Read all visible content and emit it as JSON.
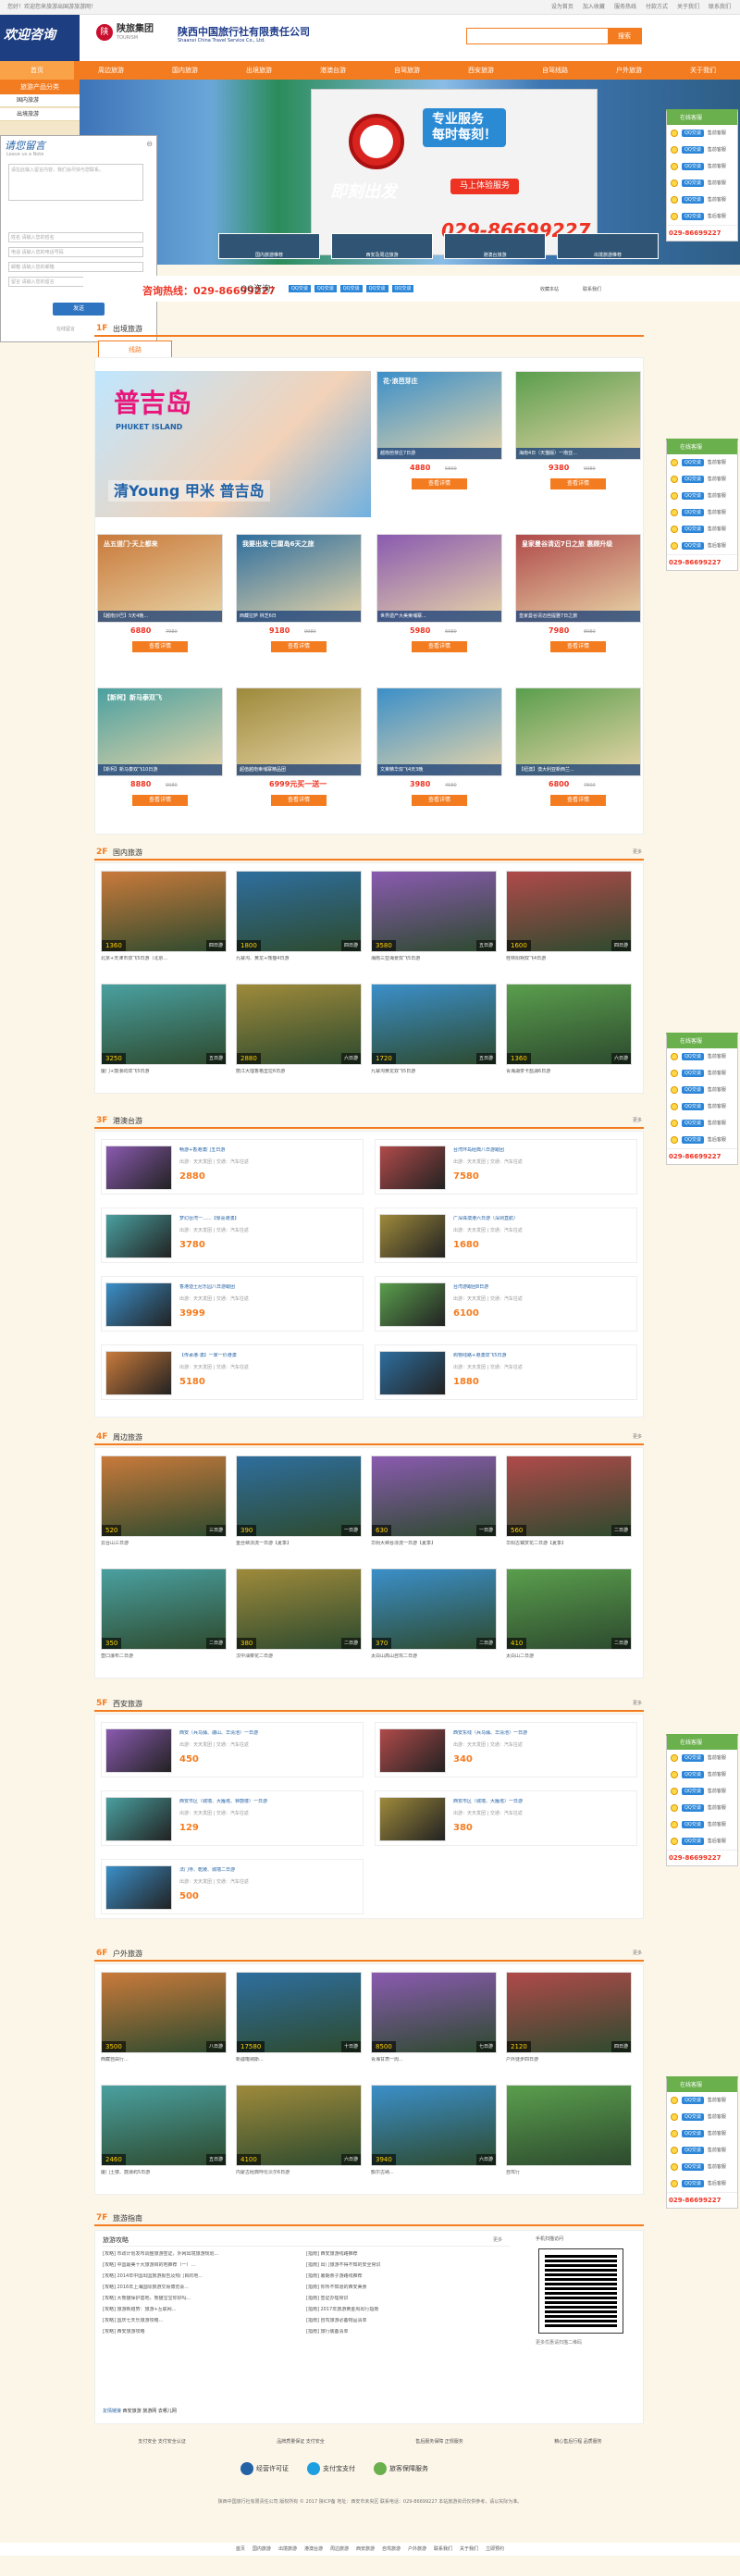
{
  "topbar": {
    "welcome": "您好！欢迎您来旅游出国游旅游网！",
    "links": [
      "设为首页",
      "加入收藏",
      "服务热线",
      "付款方式",
      "关于我们",
      "联系我们"
    ]
  },
  "header": {
    "corner": "欢迎咨询",
    "brand": "陕旅集团",
    "brand_en": "TOURISM",
    "cn": "陕西中国旅行社有限责任公司",
    "en": "Shaanxi China Travel Service Co., Ltd.",
    "search_placeholder": "",
    "search_btn": "搜索"
  },
  "nav": [
    "首页",
    "周边旅游",
    "国内旅游",
    "出境旅游",
    "港澳台游",
    "自驾旅游",
    "西安旅游",
    "自驾线路",
    "户外旅游",
    "关于我们"
  ],
  "leftmenu": {
    "title": "旅游产品分类",
    "items": [
      "国内旅游",
      "出境旅游"
    ]
  },
  "banner": {
    "clock_label": "专业服务",
    "clock_sub": "每时每刻！",
    "btn": "马上体验服务",
    "phone": "029-86699227",
    "slogan": "即刻出发",
    "thumbs": [
      "国内旅游推荐",
      "西安及周边旅游",
      "港澳台旅游",
      "出境旅游推荐"
    ]
  },
  "msgbox": {
    "title": "请您留言",
    "subtitle": "Leave us a Note",
    "textarea_ph": "请在此输入留言内容，我们会尽快与您联系。",
    "fields": [
      "姓名 请输入您的姓名",
      "电话 请输入您的电话号码",
      "邮箱 请输入您的邮箱",
      "留言 请输入您的留言"
    ],
    "send": "发送",
    "powered": "在线留言"
  },
  "cs": {
    "title": "在线客服",
    "items": [
      "售前客服",
      "售前客服",
      "售前客服",
      "售前客服",
      "售前客服",
      "售后客服"
    ],
    "qq": "QQ交谈",
    "phone": "029-86699227"
  },
  "hotline": {
    "tel": "咨询热线：029-86699227",
    "qq_label": "QQ咨询：",
    "qq": [
      "QQ交谈",
      "QQ交谈",
      "QQ交谈",
      "QQ交谈",
      "QQ交谈"
    ],
    "fav": "收藏本站",
    "contact": "联系我们"
  },
  "floors": [
    {
      "num": "1F",
      "title": "出境旅游",
      "tab": "线路"
    },
    {
      "num": "2F",
      "title": "国内旅游",
      "more": "更多"
    },
    {
      "num": "3F",
      "title": "港澳台游",
      "more": "更多"
    },
    {
      "num": "4F",
      "title": "周边旅游",
      "more": "更多"
    },
    {
      "num": "5F",
      "title": "西安旅游",
      "more": "更多"
    },
    {
      "num": "6F",
      "title": "户外旅游",
      "more": "更多"
    },
    {
      "num": "7F",
      "title": "旅游指南",
      "more": ""
    }
  ],
  "f1": {
    "big": {
      "title": "普吉岛",
      "en": "PHUKET ISLAND",
      "sub": "清Young 甲米 普吉岛"
    },
    "cards": [
      {
        "cap": "越南芭芽庄7日游",
        "price": "4880",
        "old": "5800",
        "btn": "查看详情",
        "label": "花·浪芭芽庄"
      },
      {
        "cap": "海南4日（天猫版）一南亚...",
        "price": "9380",
        "old": "9980",
        "btn": "查看详情"
      },
      {
        "cap": "【越南沙巴】5天4晚...",
        "price": "6880",
        "old": "7980",
        "btn": "查看详情",
        "label": "丛五道门·天上都来"
      },
      {
        "cap": "西藏拉萨 林芝6日",
        "price": "9180",
        "old": "9980",
        "btn": "查看详情",
        "label": "我要出发·巴厘岛6天之旅"
      },
      {
        "cap": "世界遗产大美柬埔寨...",
        "price": "5980",
        "old": "6980",
        "btn": "查看详情"
      },
      {
        "cap": "皇家曼谷清迈芭提雅7日之旅",
        "price": "7980",
        "old": "8980",
        "btn": "查看详情",
        "label": "皇家曼谷清迈7日之旅 惠顾升级"
      },
      {
        "cap": "【新柯】新马泰双飞10日游",
        "price": "8880",
        "old": "9980",
        "btn": "查看详情",
        "label": "【新柯】新马泰双飞"
      },
      {
        "cap": "超值越南柬埔寨精品团",
        "price": "6999元买一送一",
        "old": "",
        "btn": "查看详情"
      },
      {
        "cap": "文莱精华双飞4天3晚",
        "price": "3980",
        "old": "4580",
        "btn": "查看详情"
      },
      {
        "cap": "【纽澳】澳大利亚新西兰...",
        "price": "6800",
        "old": "7800",
        "btn": "查看详情"
      }
    ]
  },
  "f2": [
    {
      "cap": "北京+天津市双飞5日游（北京...",
      "price": "1360",
      "rd": "四日游"
    },
    {
      "cap": "九寨沟、黄龙+熊猫4日游",
      "price": "1800",
      "rd": "四日游"
    },
    {
      "cap": "海南三亚海景双飞5日游",
      "price": "3580",
      "rd": "五日游"
    },
    {
      "cap": "桂林阳朔双飞4日游",
      "price": "1600",
      "rd": "四日游"
    },
    {
      "cap": "厦门+鼓浪屿双飞5日游",
      "price": "3250",
      "rd": "五日游"
    },
    {
      "cap": "丽江大理香格里拉6日游",
      "price": "2880",
      "rd": "六日游"
    },
    {
      "cap": "九寨沟黄龙双飞5日游",
      "price": "1720",
      "rd": "五日游"
    },
    {
      "cap": "青海湖茶卡盐湖6日游",
      "price": "1360",
      "rd": "六日游"
    }
  ],
  "f3": [
    {
      "nm": "畅游+香港澳门五日游",
      "sb": "出游：天天发团 | 交通：汽车往返",
      "pz": "2880"
    },
    {
      "nm": "台湾环岛经典八日游跟团",
      "sb": "出游：天天发团 | 交通：汽车往返",
      "pz": "7580"
    },
    {
      "nm": "梦幻台湾一......【惊喜港澳】",
      "sb": "出游：天天发团 | 交通：汽车往返",
      "pz": "3780"
    },
    {
      "nm": "广深珠澳港六日游（深圳直航）",
      "sb": "出游：天天发团 | 交通：汽车往返",
      "pz": "1680"
    },
    {
      "nm": "香港迪士尼乐园八日游跟团",
      "sb": "出游：天天发团 | 交通：汽车往返",
      "pz": "3999"
    },
    {
      "nm": "台湾游跟团8日游",
      "sb": "出游：天天发团 | 交通：汽车往返",
      "pz": "6100"
    },
    {
      "nm": "【传承港·澳】一家一价港澳",
      "sb": "出游：天天发团 | 交通：汽车往返",
      "pz": "5180"
    },
    {
      "nm": "购物线路+港澳双飞5日游",
      "sb": "出游：天天发团 | 交通：汽车往返",
      "pz": "1880"
    }
  ],
  "f4": [
    {
      "cap": "云台山三日游",
      "price": "520",
      "rd": "三日游"
    },
    {
      "cap": "金丝峡漂流一日游【夏季】",
      "price": "390",
      "rd": "一日游"
    },
    {
      "cap": "华阴大峡谷漂流一日游【夏季】",
      "price": "630",
      "rd": "一日游"
    },
    {
      "cap": "华阳古镇赏花二日游【夏季】",
      "price": "560",
      "rd": "二日游"
    },
    {
      "cap": "壶口瀑布二日游",
      "price": "350",
      "rd": "二日游"
    },
    {
      "cap": "汉中油菜花二日游",
      "price": "380",
      "rd": "二日游"
    },
    {
      "cap": "太白山高山自驾二日游",
      "price": "370",
      "rd": "二日游"
    },
    {
      "cap": "太白山二日游",
      "price": "410",
      "rd": "二日游"
    }
  ],
  "f5": [
    {
      "nm": "西安（兵马俑、骊山、华清池）一日游",
      "sb": "出游：天天发团 | 交通：汽车往返",
      "pz": "450"
    },
    {
      "nm": "西安东线（兵马俑、华清池）一日游",
      "sb": "出游：天天发团 | 交通：汽车往返",
      "pz": "340"
    },
    {
      "nm": "西安市区（城墙、大雁塔、钟鼓楼）一日游",
      "sb": "出游：天天发团 | 交通：汽车往返",
      "pz": "129"
    },
    {
      "nm": "西安市区（城墙、大雁塔）一日游",
      "sb": "出游：天天发团 | 交通：汽车往返",
      "pz": "380"
    },
    {
      "nm": "法门寺、乾陵、城墙二日游",
      "sb": "出游：天天发团 | 交通：汽车往返",
      "pz": "500"
    }
  ],
  "f6": [
    {
      "cap": "西藏自由行...",
      "price": "3500",
      "rd": "八日游"
    },
    {
      "cap": "新疆喀纳斯...",
      "price": "17580",
      "rd": "十日游"
    },
    {
      "cap": "青海甘肃一周...",
      "price": "8500",
      "rd": "七日游"
    },
    {
      "cap": "户外徒步四日游",
      "price": "2120",
      "rd": "四日游"
    },
    {
      "cap": "厦门土楼、鼓浪屿5日游",
      "price": "2460",
      "rd": "五日游"
    },
    {
      "cap": "内蒙古经典呼伦贝尔6日游",
      "price": "4100",
      "rd": "六日游"
    },
    {
      "cap": "额尔古纳...",
      "price": "3940",
      "rd": "六日游"
    },
    {
      "cap": "自驾行",
      "price": "",
      "rd": ""
    }
  ],
  "f7": {
    "hd1": "旅游攻略",
    "hd2": "更多",
    "qr_cap": "手机扫描访问",
    "qr_sub": "更多优惠请扫描二维码",
    "left": [
      "[攻略] 市政计划发布调整旅游签证，外网出境旅游规划...",
      "[攻略] 中国最美十大旅游目的地推荐（一）...",
      "[攻略] 2014年中国出国旅游报告及热门目的地...",
      "[攻略] 2016年上海国际旅游交易博览会...",
      "[攻略] 大熊猫保护基地，熊猫宝宝你好吗...",
      "[攻略] 旅游新趋势：旅游+互联网...",
      "[攻略] 国庆七天乐旅游攻略...",
      "[攻略] 西安旅游攻略"
    ],
    "right": [
      "[指南] 西安旅游线路推荐",
      "[指南] 出门旅游不得不知的安全常识",
      "[指南] 暑期亲子游路线推荐",
      "[指南] 你所不知道的西安美食",
      "[指南] 签证办理常识",
      "[指南] 2017年旅游黄金周出行指南",
      "[指南] 自驾旅游必备物品清单",
      "[指南] 旅行装备清单"
    ],
    "tags_hd": "友情链接",
    "tags": [
      "西安旅游",
      "旅游网",
      "去哪儿网"
    ]
  },
  "footer": {
    "links": [
      "支付安全 支付安全认证",
      "品牌质量保证 支付安全",
      "售后服务保障 正规服务",
      "精心售后行程 品质服务"
    ],
    "badges": [
      "经营许可证",
      "支付宝支付",
      "旅客保障服务"
    ],
    "text": "陕西中国旅行社有限责任公司 版权所有 © 2017 陕ICP备 地址：西安市未央区 联系电话：029-86699227 本站旅游资讯仅供参考，请以实际为准。",
    "nav": [
      "首页",
      "国内旅游",
      "出境旅游",
      "港澳台游",
      "周边旅游",
      "西安旅游",
      "自驾旅游",
      "户外旅游",
      "联系我们",
      "关于我们",
      "立即预约"
    ]
  }
}
